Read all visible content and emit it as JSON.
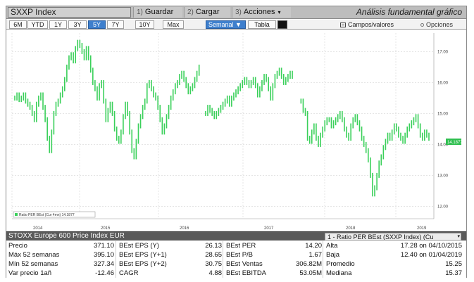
{
  "titlebar": {
    "ticker": "SXXP Index",
    "guardar": {
      "num": "1)",
      "label": "Guardar"
    },
    "cargar": {
      "num": "2)",
      "label": "Cargar"
    },
    "acciones": {
      "num": "3)",
      "label": "Acciones"
    },
    "app_title": "Análisis fundamental gráfico"
  },
  "periods": [
    {
      "label": "6M",
      "active": false
    },
    {
      "label": "YTD",
      "active": false
    },
    {
      "label": "1Y",
      "active": false
    },
    {
      "label": "3Y",
      "active": false
    },
    {
      "label": "5Y",
      "active": true
    },
    {
      "label": "7Y",
      "active": false
    },
    {
      "label": "10Y",
      "active": false
    },
    {
      "label": "Max",
      "active": false
    }
  ],
  "toolbar": {
    "frequency": "Semanal",
    "tabla": "Tabla",
    "campos": "Campos/valores",
    "opciones": "Opciones"
  },
  "colors": {
    "series": "#3ad05a",
    "active_button": "#3e7fcd"
  },
  "chart_data": {
    "type": "bar",
    "x_tick_labels": [
      "2014",
      "2015",
      "2016",
      "2017",
      "2018",
      "2019"
    ],
    "y_tick_labels": [
      "17.00",
      "16.00",
      "15.00",
      "14.00",
      "13.00",
      "12.00"
    ],
    "ylim": [
      11.6,
      17.6
    ],
    "grid": true,
    "legend": {
      "position": "bottom-left",
      "text": "Ratio PER BEst (Cur 4mn) 14.1877"
    },
    "last_value_label": "14.1877",
    "series": [
      {
        "values": [
          15.5,
          15.6,
          15.45,
          15.5,
          15.6,
          15.4,
          15.3,
          15.2,
          15.0,
          14.8,
          15.3,
          15.5,
          15.6,
          15.2,
          14.8,
          14.2,
          13.8,
          14.4,
          15.0,
          15.3,
          15.4,
          15.6,
          15.8,
          16.1,
          16.5,
          16.8,
          16.9,
          16.7,
          17.1,
          17.3,
          17.2,
          17.0,
          16.8,
          17.1,
          16.8,
          16.4,
          16.0,
          15.8,
          15.5,
          15.9,
          16.0,
          15.4,
          14.8,
          15.1,
          15.3,
          15.0,
          14.5,
          14.2,
          14.1,
          14.4,
          14.9,
          15.3,
          15.0,
          14.4,
          13.8,
          13.6,
          14.1,
          14.6,
          14.9,
          15.2,
          15.4,
          15.9,
          16.0,
          15.8,
          15.6,
          15.5,
          15.2,
          14.8,
          14.4,
          14.6,
          14.9,
          15.2,
          15.5,
          15.7,
          15.9,
          16.0,
          16.2,
          16.3,
          16.1,
          15.9,
          15.7,
          15.8,
          15.9,
          16.1,
          16.3,
          16.5,
          null,
          null,
          15.0,
          15.2,
          15.1,
          15.0,
          14.9,
          15.0,
          15.1,
          15.2,
          15.3,
          15.4,
          15.5,
          15.3,
          15.5,
          15.6,
          15.7,
          15.8,
          15.9,
          16.0,
          16.1,
          16.0,
          15.9,
          16.0,
          16.1,
          15.9,
          15.6,
          15.8,
          16.0,
          16.2,
          16.1,
          15.8,
          15.5,
          15.9,
          16.2,
          16.3,
          16.4,
          16.2,
          16.0,
          16.1,
          16.2,
          16.3,
          16.2,
          null,
          null,
          null,
          15.4,
          15.1,
          15.0,
          14.2,
          14.1,
          14.4,
          14.6,
          14.2,
          14.0,
          14.3,
          14.5,
          14.7,
          14.8,
          14.8,
          14.6,
          14.7,
          14.8,
          14.9,
          15.0,
          14.8,
          14.5,
          14.3,
          14.2,
          14.6,
          14.8,
          14.9,
          14.7,
          14.5,
          14.2,
          14.0,
          13.8,
          13.5,
          13.0,
          12.4,
          12.6,
          13.0,
          13.4,
          13.6,
          13.9,
          14.1,
          14.3,
          14.2,
          14.4,
          14.6,
          14.5,
          14.3,
          14.2,
          14.1,
          14.3,
          14.5,
          14.6,
          14.7,
          14.8,
          14.9,
          14.6,
          14.3,
          14.2,
          14.4,
          14.3,
          14.2
        ]
      }
    ]
  },
  "panel": {
    "series_name": "STOXX Europe 600 Price Index EUR",
    "ratio_select": "1 - Ratio PER BEst (SXXP Index) (Cu",
    "rows": [
      [
        [
          "Precio",
          "371.10"
        ],
        [
          "BEst EPS (Y)",
          "26.13"
        ],
        [
          "BEst PER",
          "14.20"
        ],
        [
          "Alta",
          "17.28 on 04/10/2015"
        ]
      ],
      [
        [
          "Máx 52 semanas",
          "395.10"
        ],
        [
          "BEst EPS (Y+1)",
          "28.65"
        ],
        [
          "BEst P/B",
          "1.67"
        ],
        [
          "Baja",
          "12.40 on 01/04/2019"
        ]
      ],
      [
        [
          "Mín 52 semanas",
          "327.34"
        ],
        [
          "BEst EPS (Y+2)",
          "30.75"
        ],
        [
          "BEst Ventas",
          "306.82M"
        ],
        [
          "Promedio",
          "15.25"
        ]
      ],
      [
        [
          "Var precio 1añ",
          "-12.46"
        ],
        [
          "CAGR",
          "4.88"
        ],
        [
          "BEst EBITDA",
          "53.05M"
        ],
        [
          "Mediana",
          "15.37"
        ]
      ]
    ]
  }
}
